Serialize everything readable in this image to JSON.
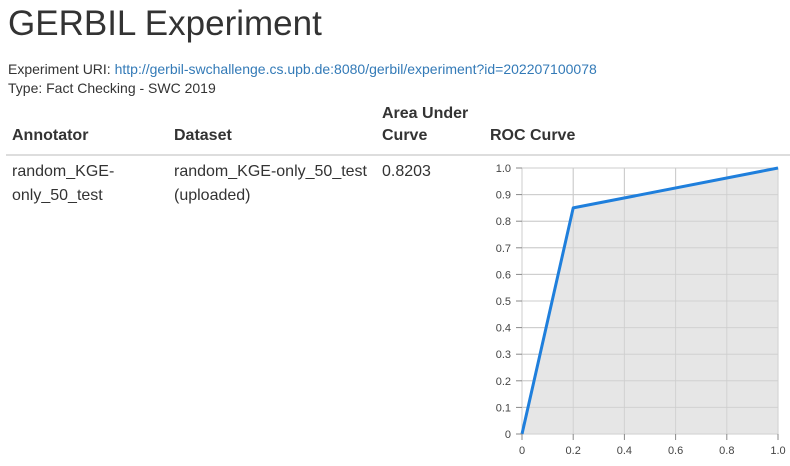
{
  "page": {
    "title": "GERBIL Experiment",
    "uri_label": "Experiment URI:",
    "uri_link": "http://gerbil-swchallenge.cs.upb.de:8080/gerbil/experiment?id=202207100078",
    "type_line": "Type: Fact Checking - SWC 2019"
  },
  "table": {
    "headers": {
      "annotator": "Annotator",
      "dataset": "Dataset",
      "auc_line1": "Area Under",
      "auc_line2": "Curve",
      "roc": "ROC Curve"
    },
    "rows": [
      {
        "annotator_line1": "random_KGE-",
        "annotator_line2": "only_50_test",
        "dataset_line1": "random_KGE-only_50_test",
        "dataset_line2": "(uploaded)",
        "auc": "0.8203"
      }
    ]
  },
  "colors": {
    "line": "#1f7fdc",
    "area": "#e3e3e3",
    "grid": "#cccccc",
    "link": "#337ab7"
  },
  "chart_data": {
    "type": "area",
    "x": [
      0,
      0.2,
      1.0
    ],
    "y": [
      0,
      0.85,
      1.0
    ],
    "xlim": [
      0,
      1
    ],
    "ylim": [
      0,
      1
    ],
    "xticks": [
      "0",
      "0.2",
      "0.4",
      "0.6",
      "0.8",
      "1.0"
    ],
    "yticks": [
      "0",
      "0.1",
      "0.2",
      "0.3",
      "0.4",
      "0.5",
      "0.6",
      "0.7",
      "0.8",
      "0.9",
      "1.0"
    ],
    "grid": true,
    "title": "",
    "xlabel": "",
    "ylabel": ""
  }
}
